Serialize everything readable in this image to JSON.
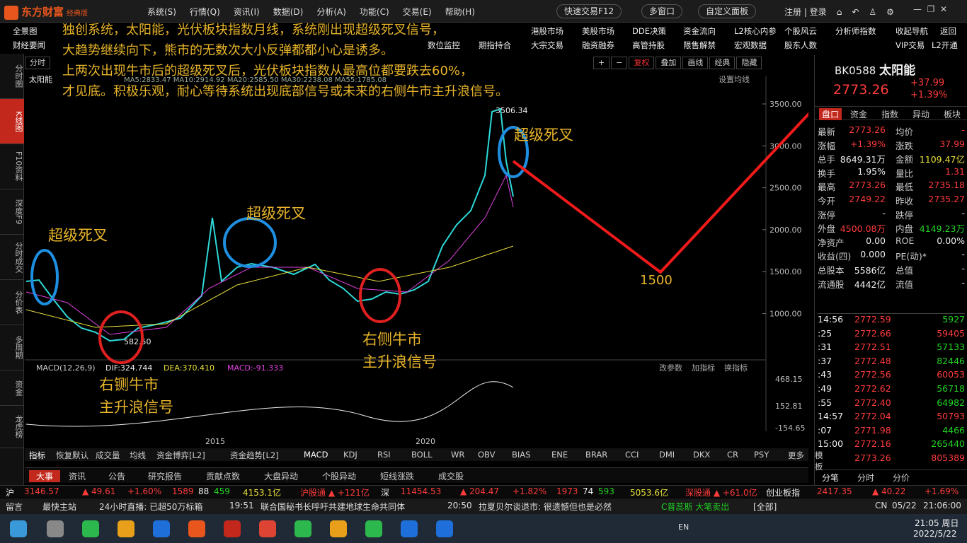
{
  "app": {
    "logo": "东方财富",
    "edition": "经典版"
  },
  "menus": [
    "系统(S)",
    "行情(Q)",
    "资讯(I)",
    "数据(D)",
    "分析(A)",
    "功能(C)",
    "交易(E)",
    "帮助(H)"
  ],
  "top_buttons": {
    "quick_trade": "快速交易F12",
    "multi_window": "多窗口",
    "custom_board": "自定义面板",
    "login": "注册 | 登录"
  },
  "nav1": [
    "全景图",
    "港股市场",
    "美股市场",
    "DDE决策",
    "资金流向",
    "L2核心内参",
    "个股风云",
    "分析师指数",
    "收起导航",
    "返回"
  ],
  "nav2": [
    "财经要闻",
    "数位监控",
    "期指持合",
    "大宗交易",
    "融资融券",
    "高管持股",
    "限售解禁",
    "宏观数据",
    "股东人数",
    "VIP交易",
    "L2开通"
  ],
  "chart_tabs": [
    "分时",
    "复权",
    "叠加",
    "画线",
    "经典",
    "隐藏"
  ],
  "left_tabs": [
    "分时图",
    "K线图",
    "F10资料",
    "深度F9",
    "分时成交",
    "分价表",
    "多周期",
    "资金",
    "龙虎榜"
  ],
  "chart": {
    "stock_label": "太阳能",
    "ma_line": "MA5:2833.47 MA10:2914.92 MA20:2585.50 MA30:2238.08 MA55:1785.08",
    "settings": "设置均线",
    "y_labels": [
      "3500.00",
      "3000.00",
      "2500.00",
      "2000.00",
      "1500.00",
      "1000.00"
    ],
    "peak_label": "3506.34",
    "low_label": "582.50",
    "x_labels": [
      "2015",
      "2020"
    ],
    "macd_title": "MACD(12,26,9)",
    "macd_dif": "DIF:324.744",
    "macd_dea": "DEA:370.410",
    "macd_val": "MACD:-91.333",
    "macd_y": [
      "468.15",
      "152.81",
      "-154.65"
    ],
    "macd_tools": [
      "改参数",
      "加指标",
      "换指标"
    ]
  },
  "annotation": "独创系统，太阳能，光伏板块指数月线，系统刚出现超级死叉信号，\n大趋势继续向下，熊市的无数次大小反弹都都小心是诱多。\n上两次出现牛市后的超级死叉后，光伏板块指数从最高位都要跌去60%，\n才见底。积极乐观，耐心等待系统出现底部信号或未来的右侧牛市主升浪信号。",
  "marks": {
    "dead_cross": "超级死叉",
    "bull_signal_1": "右铡牛市\n主升浪信号",
    "bull_signal_2": "右侧牛市\n主升浪信号",
    "target": "1500"
  },
  "right": {
    "code": "BK0588",
    "name": "太阳能",
    "price": "2773.26",
    "change": "+37.99",
    "pct": "+1.39%",
    "tabs": [
      "盘口",
      "资金",
      "指数",
      "异动",
      "板块"
    ],
    "quote": [
      [
        "最新",
        "2773.26",
        "均价",
        "-"
      ],
      [
        "涨幅",
        "+1.39%",
        "涨跌",
        "37.99"
      ],
      [
        "总手",
        "8649.31万",
        "金额",
        "1109.47亿"
      ],
      [
        "换手",
        "1.95%",
        "量比",
        "1.31"
      ],
      [
        "最高",
        "2773.26",
        "最低",
        "2735.18"
      ],
      [
        "今开",
        "2749.22",
        "昨收",
        "2735.27"
      ],
      [
        "涨停",
        "-",
        "跌停",
        "-"
      ],
      [
        "外盘",
        "4500.08万",
        "内盘",
        "4149.23万"
      ],
      [
        "净资产",
        "0.00",
        "ROE",
        "0.00%"
      ],
      [
        "收益(四)",
        "0.000",
        "PE(动)*",
        "-"
      ],
      [
        "总股本",
        "5586亿",
        "总值",
        "-"
      ],
      [
        "流通股",
        "4442亿",
        "流值",
        "-"
      ]
    ],
    "ticks": [
      [
        "14:56",
        "2772.59",
        "5927"
      ],
      [
        ":25",
        "2772.66",
        "59405"
      ],
      [
        ":31",
        "2772.51",
        "57133"
      ],
      [
        ":37",
        "2772.48",
        "82446"
      ],
      [
        ":43",
        "2772.56",
        "60053"
      ],
      [
        ":49",
        "2772.62",
        "56718"
      ],
      [
        ":55",
        "2772.40",
        "64982"
      ],
      [
        "14:57",
        "2772.04",
        "50793"
      ],
      [
        ":07",
        "2771.98",
        "4466"
      ],
      [
        "15:00",
        "2772.16",
        "265440"
      ],
      [
        "",
        "2773.26",
        "805389"
      ]
    ],
    "bottom_tabs": [
      "分笔",
      "分价",
      "分价"
    ]
  },
  "bottom_tabs": [
    "指标",
    "恢复默认",
    "成交量",
    "均线",
    "资金博弈[L2]",
    "资金趋势[L2]",
    "MACD",
    "KDJ",
    "RSI",
    "BOLL",
    "WR",
    "OBV",
    "BIAS",
    "ENE",
    "BRAR",
    "CCI",
    "DMI",
    "DKX",
    "CR",
    "PSY",
    "更多",
    "模板"
  ],
  "news_tabs": [
    "大事",
    "资讯",
    "公告",
    "研究报告",
    "贡献点数",
    "大盘异动",
    "个股异动",
    "短线涨跌",
    "成交股"
  ],
  "index_bar": {
    "sh": "沪",
    "sh_val": "3146.57",
    "sh_chg": "▲ 49.61",
    "sh_pct": "+1.60%",
    "sh_up": "1589",
    "sh_flat": "88",
    "sh_down": "459",
    "sh_amt": "4153.1亿",
    "hgt": "沪股通 ▲ +121亿",
    "sz": "深",
    "sz_val": "11454.53",
    "sz_chg": "▲ 204.47",
    "sz_pct": "+1.82%",
    "sz_up": "1973",
    "sz_flat": "74",
    "sz_down": "593",
    "sz_amt": "5053.6亿",
    "sgt": "深股通 ▲ +61.0亿",
    "cyb": "创业板指",
    "cyb_val": "2417.35",
    "cyb_chg": "▲ 40.22",
    "cyb_pct": "+1.69%"
  },
  "status": {
    "msg": "留言",
    "tip": "最快主站",
    "live": "24小时直播: 已超50万标箱",
    "t1": "19:51",
    "n1": "联合国秘书长呼吁共建地球生命共同体",
    "t2": "20:50",
    "n2": "拉夏贝尔谈退市: 很遗憾但也是必然",
    "ticker": "C普蕊斯 大笔卖出",
    "all": "[全部]",
    "lang": "CN",
    "date": "05/22",
    "time": "21:06:00"
  },
  "taskbar": {
    "clock": "21:05 周日",
    "date": "2022/5/22",
    "lang": "EN"
  }
}
